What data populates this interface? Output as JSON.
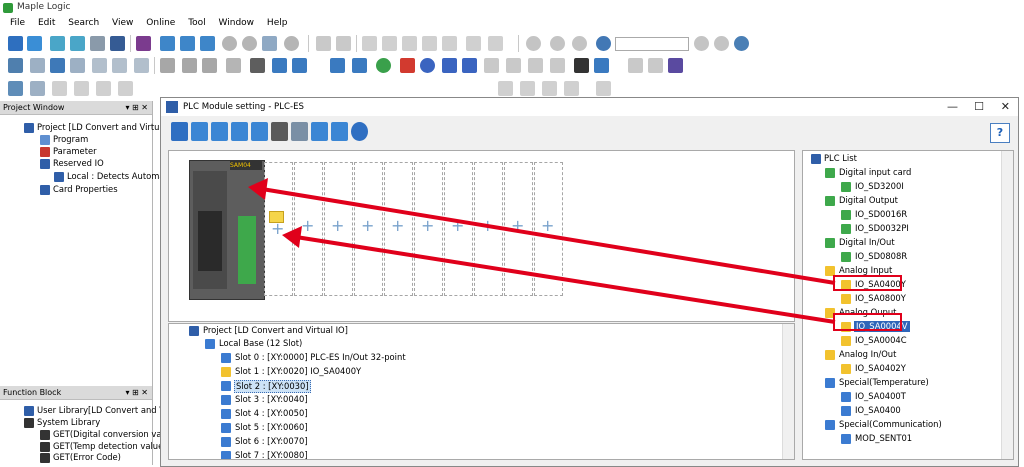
{
  "app": {
    "title": "Maple Logic"
  },
  "menu": [
    "File",
    "Edit",
    "Search",
    "View",
    "Online",
    "Tool",
    "Window",
    "Help"
  ],
  "project_window": {
    "header": "Project Window",
    "pins": "▾ ⊞ ✕",
    "items": [
      "Project [LD Convert and Virtual I",
      "Program",
      "Parameter",
      "Reserved IO",
      "Local : Detects Automat",
      "Card Properties"
    ]
  },
  "function_block": {
    "header": "Function Block",
    "pins": "▾ ⊞ ✕",
    "items": [
      "User Library[LD Convert and Virt",
      "System Library",
      "GET(Digital conversion value",
      "GET(Temp detection value)",
      "GET(Error Code)"
    ]
  },
  "dialog": {
    "title": "PLC Module setting - PLC-ES",
    "min": "—",
    "max": "☐",
    "close": "✕",
    "help": "?",
    "plus": "+",
    "plc_label": "SAM04"
  },
  "project_tree": {
    "root": "Project [LD Convert and Virtual IO]",
    "base": "Local Base (12 Slot)",
    "slots": [
      "Slot 0 : [XY:0000] PLC-ES In/Out 32-point",
      "Slot 1 : [XY:0020] IO_SA0400Y",
      "Slot 2 : [XY:0030]",
      "Slot 3 : [XY:0040]",
      "Slot 4 : [XY:0050]",
      "Slot 5 : [XY:0060]",
      "Slot 6 : [XY:0070]",
      "Slot 7 : [XY:0080]"
    ]
  },
  "plc_list": {
    "title": "PLC List",
    "groups": [
      {
        "name": "Digital input card",
        "badge": "DI",
        "items": [
          "IO_SD3200I"
        ]
      },
      {
        "name": "Digital Output",
        "badge": "DO",
        "items": [
          "IO_SD0016R",
          "IO_SD0032PI"
        ]
      },
      {
        "name": "Digital In/Out",
        "badge": "DIO",
        "items": [
          "IO_SD0808R"
        ]
      },
      {
        "name": "Analog Input",
        "badge": "AI",
        "items": [
          "IO_SA0400Y",
          "IO_SA0800Y"
        ]
      },
      {
        "name": "Analog Ouput",
        "badge": "AO",
        "items": [
          "IO_SA0004V",
          "IO_SA0004C"
        ]
      },
      {
        "name": "Analog In/Out",
        "badge": "AIO",
        "items": [
          "IO_SA0402Y"
        ]
      },
      {
        "name": "Special(Temperature)",
        "badge": "ST",
        "items": [
          "IO_SA0400T",
          "IO_SA0400"
        ]
      },
      {
        "name": "Special(Communication)",
        "badge": "SC",
        "items": [
          "MOD_SENT01"
        ]
      }
    ]
  },
  "colors": {
    "annotation_red": "#e0001b",
    "selection_blue": "#2f66b9",
    "brand_green": "#2f9a3a"
  }
}
